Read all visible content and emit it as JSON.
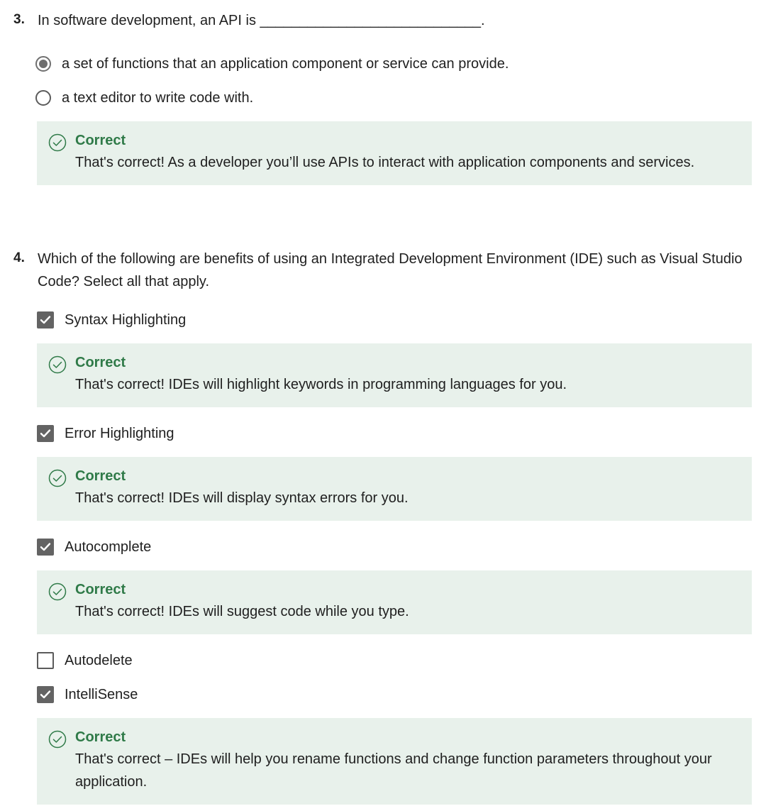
{
  "questions": [
    {
      "number": "3.",
      "text": "In software development, an API is ____________________________.",
      "options": [
        {
          "label": "a set of functions that an application component or service can provide.",
          "selected": true
        },
        {
          "label": "a text editor to write code with.",
          "selected": false
        }
      ],
      "feedback": {
        "title": "Correct",
        "text": "That's correct! As a developer you’ll use APIs to interact with application components and services."
      }
    },
    {
      "number": "4.",
      "text": "Which of the following are benefits of using an Integrated Development Environment (IDE) such as Visual Studio Code? Select all that apply.",
      "options": [
        {
          "label": "Syntax Highlighting",
          "checked": true,
          "feedback": {
            "title": "Correct",
            "text": "That's correct! IDEs will highlight keywords in programming languages for you."
          }
        },
        {
          "label": "Error Highlighting",
          "checked": true,
          "feedback": {
            "title": "Correct",
            "text": "That's correct! IDEs will display syntax errors for you."
          }
        },
        {
          "label": "Autocomplete",
          "checked": true,
          "feedback": {
            "title": "Correct",
            "text": "That's correct! IDEs will suggest code while you type."
          }
        },
        {
          "label": "Autodelete",
          "checked": false
        },
        {
          "label": "IntelliSense",
          "checked": true,
          "feedback": {
            "title": "Correct",
            "text": "That's correct – IDEs will help you rename functions and change function parameters throughout your application."
          }
        }
      ]
    }
  ],
  "icons": {
    "feedback": "check-circle-icon",
    "checkbox": "checkmark-icon",
    "radio": "radio-dot-icon"
  },
  "colors": {
    "feedback_bg": "#e8f1eb",
    "correct_green": "#2f7a48",
    "control_gray": "#636363"
  }
}
